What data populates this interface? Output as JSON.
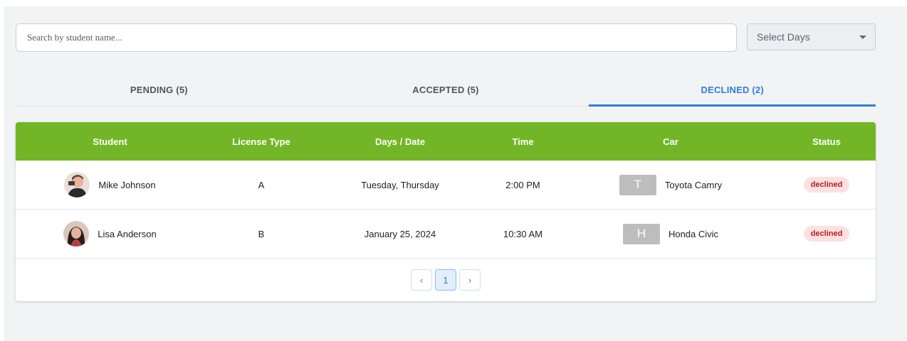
{
  "search": {
    "placeholder": "Search by student name..."
  },
  "filter": {
    "selected": "Select Days"
  },
  "tabs": [
    {
      "label": "PENDING (5)",
      "active": false
    },
    {
      "label": "ACCEPTED (5)",
      "active": false
    },
    {
      "label": "DECLINED (2)",
      "active": true
    }
  ],
  "table": {
    "header_color": "#72b627",
    "columns": [
      "Student",
      "License Type",
      "Days / Date",
      "Time",
      "Car",
      "Status"
    ],
    "rows": [
      {
        "student": "Mike Johnson",
        "license": "A",
        "days": "Tuesday, Thursday",
        "time": "2:00 PM",
        "car_initial": "T",
        "car": "Toyota Camry",
        "status": "declined"
      },
      {
        "student": "Lisa Anderson",
        "license": "B",
        "days": "January 25, 2024",
        "time": "10:30 AM",
        "car_initial": "H",
        "car": "Honda Civic",
        "status": "declined"
      }
    ]
  },
  "pagination": {
    "prev": "‹",
    "current": "1",
    "next": "›"
  },
  "colors": {
    "accent": "#2f7fd6",
    "status_declined_bg": "#fde1e1",
    "status_declined_text": "#b71c1c"
  }
}
